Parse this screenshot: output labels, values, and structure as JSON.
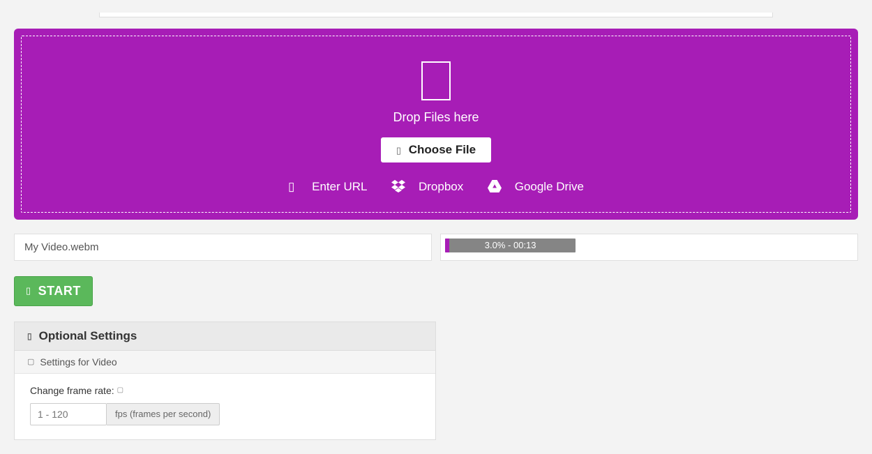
{
  "dropzone": {
    "title": "Drop Files here",
    "choose_label": "Choose File",
    "enter_url_label": "Enter URL",
    "dropbox_label": "Dropbox",
    "gdrive_label": "Google Drive"
  },
  "file": {
    "name": "My Video.webm",
    "progress_text": "3.0% - 00:13",
    "progress_percent": 3
  },
  "start_label": "START",
  "optional": {
    "title": "Optional Settings",
    "video_title": "Settings for Video",
    "frame_rate_label": "Change frame rate:",
    "fps_placeholder": "1 - 120",
    "fps_unit": "fps (frames per second)"
  }
}
